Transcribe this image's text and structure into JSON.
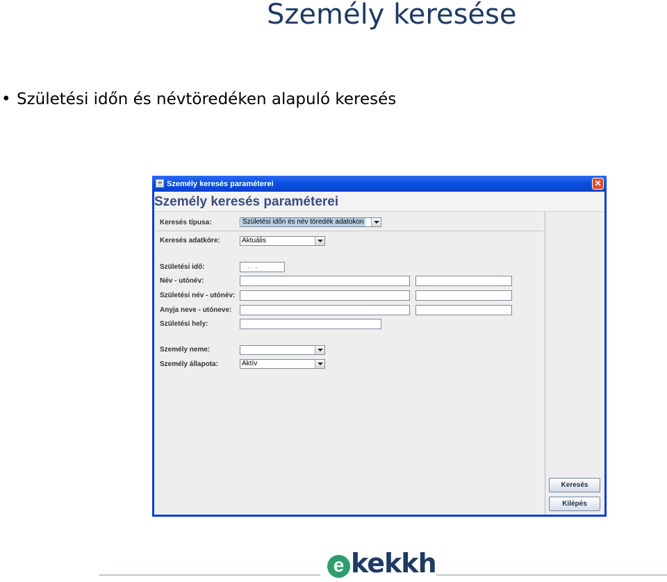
{
  "slide": {
    "title": "Személy keresése",
    "bullet": "Születési időn és névtöredéken alapuló keresés"
  },
  "window": {
    "title": "Személy keresés paraméterei",
    "heading": "Személy keresés paraméterei",
    "icon": "java-cup-icon",
    "close_icon": "close-icon"
  },
  "form": {
    "search_type": {
      "label": "Keresés típusa:",
      "value": "Születési időn és név töredék adatokon"
    },
    "search_scope": {
      "label": "Keresés adatköre:",
      "value": "Aktuális"
    },
    "birth_date": {
      "label": "Születési idő:",
      "value": ". ."
    },
    "name": {
      "label": "Név - utónév:",
      "surname": "",
      "given": ""
    },
    "birth_name": {
      "label": "Születési név - utónév:",
      "surname": "",
      "given": ""
    },
    "mother_name": {
      "label": "Anyja neve - utóneve:",
      "surname": "",
      "given": ""
    },
    "birth_place": {
      "label": "Születési hely:",
      "value": ""
    },
    "sex": {
      "label": "Személy neme:",
      "value": ""
    },
    "status": {
      "label": "Személy állapota:",
      "value": "Aktív"
    }
  },
  "buttons": {
    "search": "Keresés",
    "exit": "Kilépés"
  },
  "footer": {
    "logo_letter": "e",
    "logo_text": "kekkh"
  },
  "colors": {
    "title_text": "#1f3b63",
    "window_frame": "#0a3dd6",
    "form_heading": "#3c4b80",
    "logo_green": "#2f9d6e"
  }
}
